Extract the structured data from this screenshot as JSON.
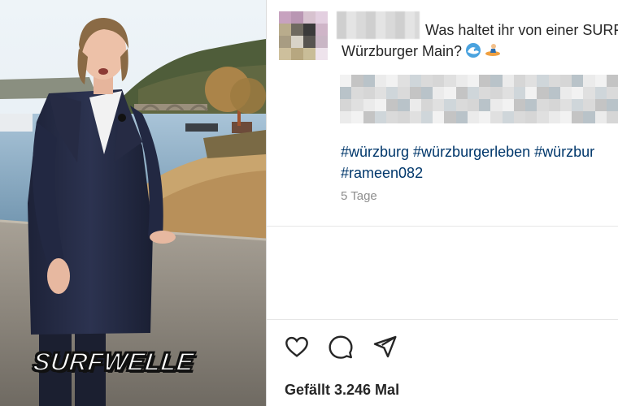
{
  "photo": {
    "alt": "Frau im dunklen Mantel an einer Mauer am Main",
    "sticker_text": "SURFWELLE"
  },
  "post": {
    "caption_line1": "Was haltet ihr von einer SURF",
    "caption_line2": "Würzburger Main?",
    "emoji_1": "wave-emoji",
    "emoji_2": "surfer-emoji",
    "hashtags_line1": "#würzburg #würzburgerleben #würzbur",
    "hashtags_line2": "#rameen082",
    "timestamp": "5 Tage",
    "likes": "Gefällt 3.246 Mal"
  },
  "actions": {
    "like_icon": "heart-icon",
    "comment_icon": "comment-icon",
    "share_icon": "send-icon"
  },
  "colors": {
    "text": "#262626",
    "hashtag": "#00376b",
    "muted": "#8e8e8e",
    "divider": "#dbdbdb"
  }
}
